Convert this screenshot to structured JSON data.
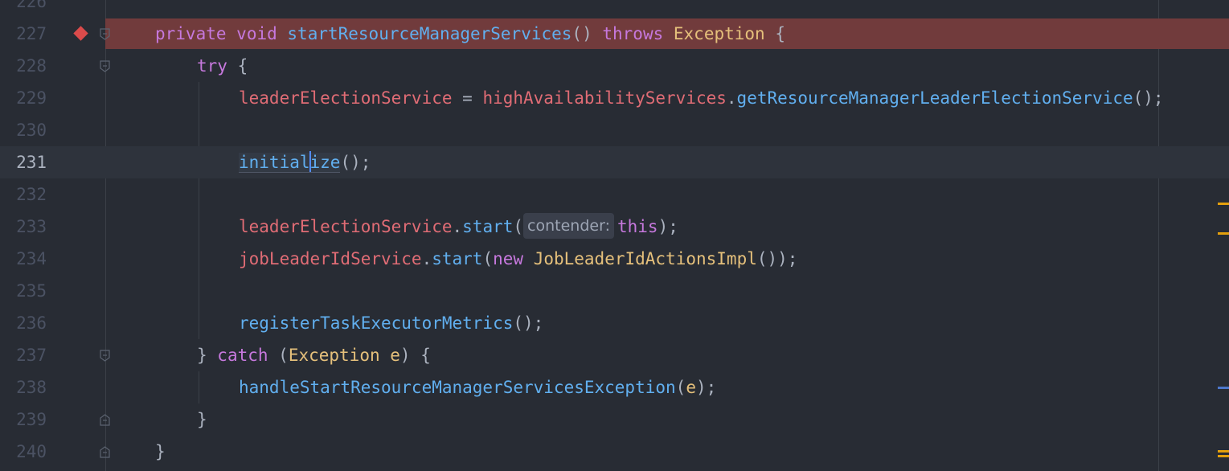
{
  "editor": {
    "lines": [
      {
        "n": "226"
      },
      {
        "n": "227"
      },
      {
        "n": "228"
      },
      {
        "n": "229"
      },
      {
        "n": "230"
      },
      {
        "n": "231"
      },
      {
        "n": "232"
      },
      {
        "n": "233"
      },
      {
        "n": "234"
      },
      {
        "n": "235"
      },
      {
        "n": "236"
      },
      {
        "n": "237"
      },
      {
        "n": "238"
      },
      {
        "n": "239"
      },
      {
        "n": "240"
      }
    ],
    "code": {
      "l227": {
        "k1": "private",
        "k2": "void",
        "fn": "startResourceManagerServices",
        "p": "()",
        "k3": "throws",
        "ty": "Exception",
        "b": "{"
      },
      "l228": {
        "k": "try",
        "b": "{"
      },
      "l229": {
        "f1": "leaderElectionService",
        "eq": " = ",
        "f2": "highAvailabilityServices",
        "dot": ".",
        "fn": "getResourceManagerLeaderElectionService",
        "end": "();"
      },
      "l231": {
        "fn_a": "initial",
        "fn_b": "ize",
        "end": "();"
      },
      "l233": {
        "f": "leaderElectionService",
        "dot": ".",
        "fn": "start",
        "op": "(",
        "hint": "contender:",
        "k": "this",
        "end": ");"
      },
      "l234": {
        "f": "jobLeaderIdService",
        "dot": ".",
        "fn": "start",
        "op": "(",
        "k": "new",
        "ty": "JobLeaderIdActionsImpl",
        "end": "());"
      },
      "l236": {
        "fn": "registerTaskExecutorMetrics",
        "end": "();"
      },
      "l237": {
        "b1": "} ",
        "k": "catch",
        "op": " (",
        "ty": "Exception",
        "par": "e",
        "end": ") {"
      },
      "l238": {
        "fn": "handleStartResourceManagerServicesException",
        "op": "(",
        "par": "e",
        "end": ");"
      },
      "l239": {
        "b": "}"
      },
      "l240": {
        "b": "}"
      }
    }
  },
  "colors": {
    "background": "#282c34",
    "breakpoint_line": "#713b3c",
    "breakpoint": "#db4b4b",
    "keyword": "#c678dd",
    "type": "#e5c07b",
    "function": "#61afef",
    "field": "#e06c75",
    "caret": "#528bff",
    "warning_marker": "#e5a00d",
    "info_marker": "#4d78cc"
  },
  "icons": {
    "breakpoint": "breakpoint-icon",
    "fold_open": "fold-open-icon",
    "fold_close": "fold-close-icon"
  }
}
